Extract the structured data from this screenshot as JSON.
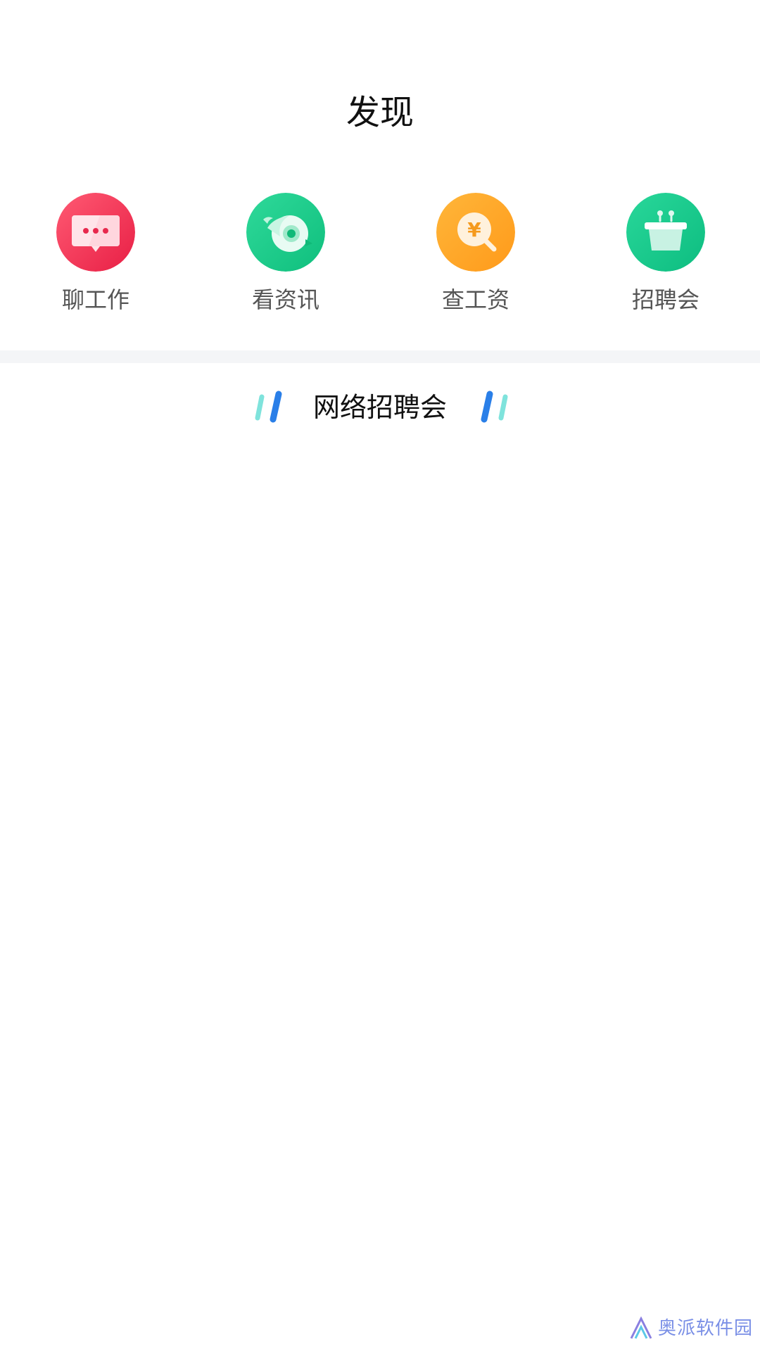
{
  "header": {
    "title": "发现"
  },
  "quick_actions": [
    {
      "label": "聊工作",
      "icon": "chat-icon",
      "color": "#f0395b"
    },
    {
      "label": "看资讯",
      "icon": "news-eye-icon",
      "color": "#19c98a"
    },
    {
      "label": "查工资",
      "icon": "salary-search-icon",
      "color": "#ffa525"
    },
    {
      "label": "招聘会",
      "icon": "job-fair-podium-icon",
      "color": "#16c98c"
    }
  ],
  "section": {
    "title": "网络招聘会",
    "decoration_colors": [
      "#7fe3dc",
      "#2a7fe8"
    ]
  },
  "watermark": {
    "text": "奥派软件园"
  }
}
